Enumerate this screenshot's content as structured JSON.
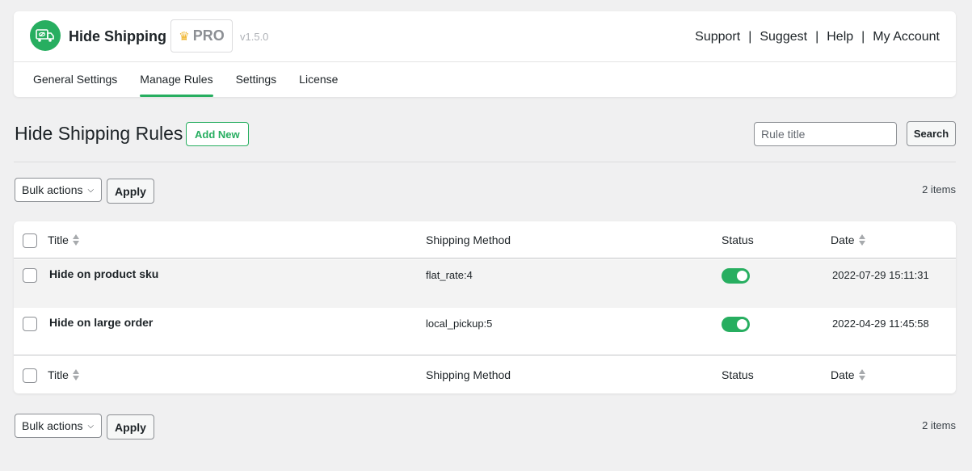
{
  "header": {
    "brand_name": "Hide Shipping",
    "pro_badge": "PRO",
    "version": "v1.5.0",
    "links": [
      "Support",
      "Suggest",
      "Help",
      "My Account"
    ],
    "separator": "|",
    "accent_color": "#27ae60"
  },
  "nav": {
    "tabs": [
      {
        "label": "General Settings",
        "active": false
      },
      {
        "label": "Manage Rules",
        "active": true
      },
      {
        "label": "Settings",
        "active": false
      },
      {
        "label": "License",
        "active": false
      }
    ]
  },
  "page": {
    "title": "Hide Shipping Rules",
    "add_new_label": "Add New",
    "search_placeholder": "Rule title",
    "search_value": "",
    "search_button": "Search"
  },
  "toolbar_top": {
    "bulk_actions": "Bulk actions",
    "apply": "Apply",
    "count": "2 items"
  },
  "toolbar_bottom": {
    "bulk_actions": "Bulk actions",
    "apply": "Apply",
    "count": "2 items"
  },
  "table": {
    "columns": [
      "Title",
      "Shipping Method",
      "Status",
      "Date"
    ],
    "rows": [
      {
        "title": "Hide on product sku",
        "shipping_method": "flat_rate:4",
        "status": "enabled",
        "date": "2022-07-29 15:11:31"
      },
      {
        "title": "Hide on large order",
        "shipping_method": "local_pickup:5",
        "status": "enabled",
        "date": "2022-04-29 11:45:58"
      }
    ]
  }
}
